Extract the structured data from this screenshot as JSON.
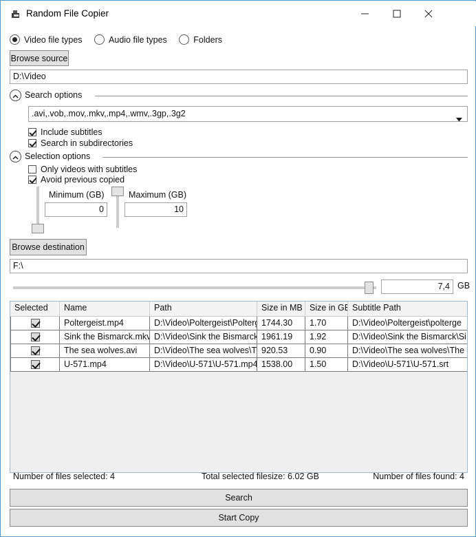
{
  "window": {
    "title": "Random File Copier",
    "icon": "copier-icon",
    "controls": {
      "minimize": "minimize-icon",
      "maximize": "maximize-icon",
      "close": "close-icon"
    }
  },
  "filetype_radios": [
    {
      "label": "Video file types",
      "selected": true
    },
    {
      "label": "Audio file types",
      "selected": false
    },
    {
      "label": "Folders",
      "selected": false
    }
  ],
  "source": {
    "browse_label": "Browse source",
    "path_value": "D:\\Video"
  },
  "search_options": {
    "group_label": "Search options",
    "expander": "chevron-up-icon",
    "extensions_value": ".avi,.vob,.mov,.mkv,.mp4,.wmv,.3gp,.3g2",
    "checkboxes": [
      {
        "label": "Include subtitles",
        "checked": true
      },
      {
        "label": "Search in subdirectories",
        "checked": true
      }
    ]
  },
  "selection_options": {
    "group_label": "Selection options",
    "expander": "chevron-up-icon",
    "checkboxes": [
      {
        "label": "Only videos with subtitles",
        "checked": false
      },
      {
        "label": "Avoid previous copied",
        "checked": true
      }
    ],
    "minimum_label": "Minimum (GB)",
    "minimum_value": "0",
    "maximum_label": "Maximum (GB)",
    "maximum_value": "10"
  },
  "destination": {
    "browse_label": "Browse destination",
    "path_value": "F:\\",
    "size_value": "7,4",
    "size_unit": "GB"
  },
  "table": {
    "columns": [
      "Selected",
      "Name",
      "Path",
      "Size in MB",
      "Size in GB",
      "Subtitle Path"
    ],
    "rows": [
      {
        "selected": true,
        "name": "Poltergeist.mp4",
        "path": "D:\\Video\\Poltergeist\\Poltergei",
        "size_mb": "1744.30",
        "size_gb": "1.70",
        "subtitle_path": "D:\\Video\\Poltergeist\\polterge"
      },
      {
        "selected": true,
        "name": "Sink the Bismarck.mkv",
        "path": "D:\\Video\\Sink the Bismarck\\Si",
        "size_mb": "1961.19",
        "size_gb": "1.92",
        "subtitle_path": "D:\\Video\\Sink the Bismarck\\Si"
      },
      {
        "selected": true,
        "name": "The sea wolves.avi",
        "path": "D:\\Video\\The sea wolves\\The",
        "size_mb": "920.53",
        "size_gb": "0.90",
        "subtitle_path": "D:\\Video\\The sea wolves\\The"
      },
      {
        "selected": true,
        "name": "U-571.mp4",
        "path": "D:\\Video\\U-571\\U-571.mp4",
        "size_mb": "1538.00",
        "size_gb": "1.50",
        "subtitle_path": "D:\\Video\\U-571\\U-571.srt"
      }
    ]
  },
  "status": {
    "files_selected": "Number of files selected: 4",
    "total_filesize": "Total selected filesize: 6.02 GB",
    "files_found": "Number of files found: 4"
  },
  "actions": {
    "search_label": "Search",
    "start_copy_label": "Start Copy"
  },
  "colors": {
    "window_border": "#4a9ad4",
    "button_face": "#e1e1e1",
    "list_background": "#efefef",
    "track": "#cdcdcd"
  }
}
